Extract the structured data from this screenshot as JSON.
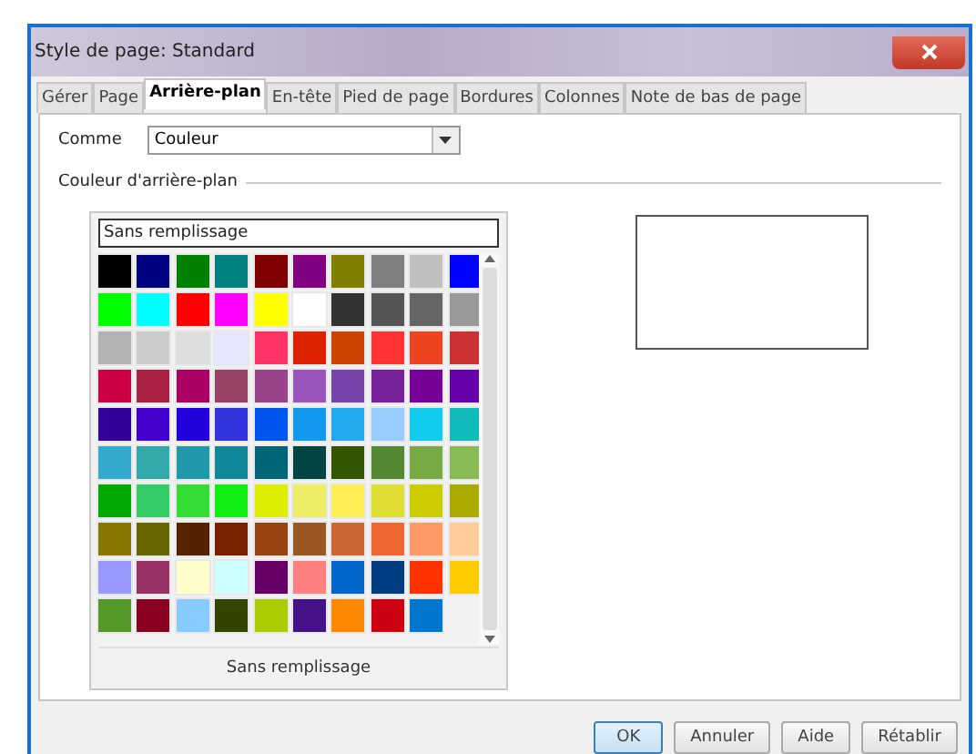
{
  "window": {
    "title": "Style de page: Standard"
  },
  "tabs": [
    {
      "label": "Gérer",
      "selected": false
    },
    {
      "label": "Page",
      "selected": false
    },
    {
      "label": "Arrière-plan",
      "selected": true
    },
    {
      "label": "En-tête",
      "selected": false
    },
    {
      "label": "Pied de page",
      "selected": false
    },
    {
      "label": "Bordures",
      "selected": false
    },
    {
      "label": "Colonnes",
      "selected": false
    },
    {
      "label": "Note de bas de page",
      "selected": false
    }
  ],
  "as": {
    "label": "Comme",
    "value": "Couleur"
  },
  "background": {
    "label": "Couleur d'arrière-plan",
    "field_value": "Sans remplissage",
    "footer": "Sans remplissage",
    "swatches": [
      {
        "color": "#000000"
      },
      {
        "color": "#000080"
      },
      {
        "color": "#008000"
      },
      {
        "color": "#008080"
      },
      {
        "color": "#800000"
      },
      {
        "color": "#800080"
      },
      {
        "color": "#808000"
      },
      {
        "color": "#808080"
      },
      {
        "color": "#c0c0c0"
      },
      {
        "color": "#0000ff"
      },
      {
        "color": "#00ff00"
      },
      {
        "color": "#00ffff"
      },
      {
        "color": "#ff0000"
      },
      {
        "color": "#ff00ff"
      },
      {
        "color": "#ffff00"
      },
      {
        "color": "#ffffff"
      },
      {
        "color": "#333333"
      },
      {
        "color": "#555555"
      },
      {
        "color": "#666666"
      },
      {
        "color": "#999999"
      },
      {
        "color": "#b3b3b3"
      },
      {
        "color": "#cccccc"
      },
      {
        "color": "#dddddd"
      },
      {
        "color": "#e6e6ff"
      },
      {
        "color": "#ff3366"
      },
      {
        "color": "#dd2200"
      },
      {
        "color": "#cc4400"
      },
      {
        "color": "#ff3333"
      },
      {
        "color": "#ee4422"
      },
      {
        "color": "#cc3333"
      },
      {
        "color": "#cc0044"
      },
      {
        "color": "#aa2244"
      },
      {
        "color": "#aa0066"
      },
      {
        "color": "#994466"
      },
      {
        "color": "#994488"
      },
      {
        "color": "#9955bb"
      },
      {
        "color": "#7744aa"
      },
      {
        "color": "#772299"
      },
      {
        "color": "#770099"
      },
      {
        "color": "#6600aa"
      },
      {
        "color": "#330099"
      },
      {
        "color": "#4400cc"
      },
      {
        "color": "#2200dd"
      },
      {
        "color": "#3333dd"
      },
      {
        "color": "#0055ee"
      },
      {
        "color": "#1199ee"
      },
      {
        "color": "#22aaee"
      },
      {
        "color": "#99ccff"
      },
      {
        "color": "#11ccee"
      },
      {
        "color": "#11bbbb"
      },
      {
        "color": "#33aacc"
      },
      {
        "color": "#33aaaa"
      },
      {
        "color": "#2299aa"
      },
      {
        "color": "#118899"
      },
      {
        "color": "#006677"
      },
      {
        "color": "#004444"
      },
      {
        "color": "#335500"
      },
      {
        "color": "#558833"
      },
      {
        "color": "#77aa44"
      },
      {
        "color": "#88bb55"
      },
      {
        "color": "#00aa00"
      },
      {
        "color": "#33cc66"
      },
      {
        "color": "#33dd33"
      },
      {
        "color": "#11ee11"
      },
      {
        "color": "#ddee00"
      },
      {
        "color": "#eeee66"
      },
      {
        "color": "#ffee55"
      },
      {
        "color": "#dddd33"
      },
      {
        "color": "#cccc00"
      },
      {
        "color": "#aaaa00"
      },
      {
        "color": "#887700"
      },
      {
        "color": "#666600"
      },
      {
        "color": "#552200"
      },
      {
        "color": "#772200"
      },
      {
        "color": "#994411"
      },
      {
        "color": "#995522"
      },
      {
        "color": "#cc6633"
      },
      {
        "color": "#ee6633"
      },
      {
        "color": "#ff9966"
      },
      {
        "color": "#ffcc99"
      },
      {
        "color": "#9999ff"
      },
      {
        "color": "#993366"
      },
      {
        "color": "#ffffcc"
      },
      {
        "color": "#ccffff"
      },
      {
        "color": "#660066"
      },
      {
        "color": "#ff8080"
      },
      {
        "color": "#0066cc"
      },
      {
        "color": "#003d80"
      },
      {
        "color": "#ff3300"
      },
      {
        "color": "#ffcc00"
      },
      {
        "color": "#55992a"
      },
      {
        "color": "#880022"
      },
      {
        "color": "#88ccff"
      },
      {
        "color": "#334400"
      },
      {
        "color": "#aacc00"
      },
      {
        "color": "#441188"
      },
      {
        "color": "#ff8800"
      },
      {
        "color": "#cc0011"
      },
      {
        "color": "#0077cc"
      }
    ]
  },
  "buttons": [
    {
      "label": "OK",
      "selected": true
    },
    {
      "label": "Annuler",
      "selected": false
    },
    {
      "label": "Aide",
      "selected": false
    },
    {
      "label": "Rétablir",
      "selected": false
    }
  ]
}
